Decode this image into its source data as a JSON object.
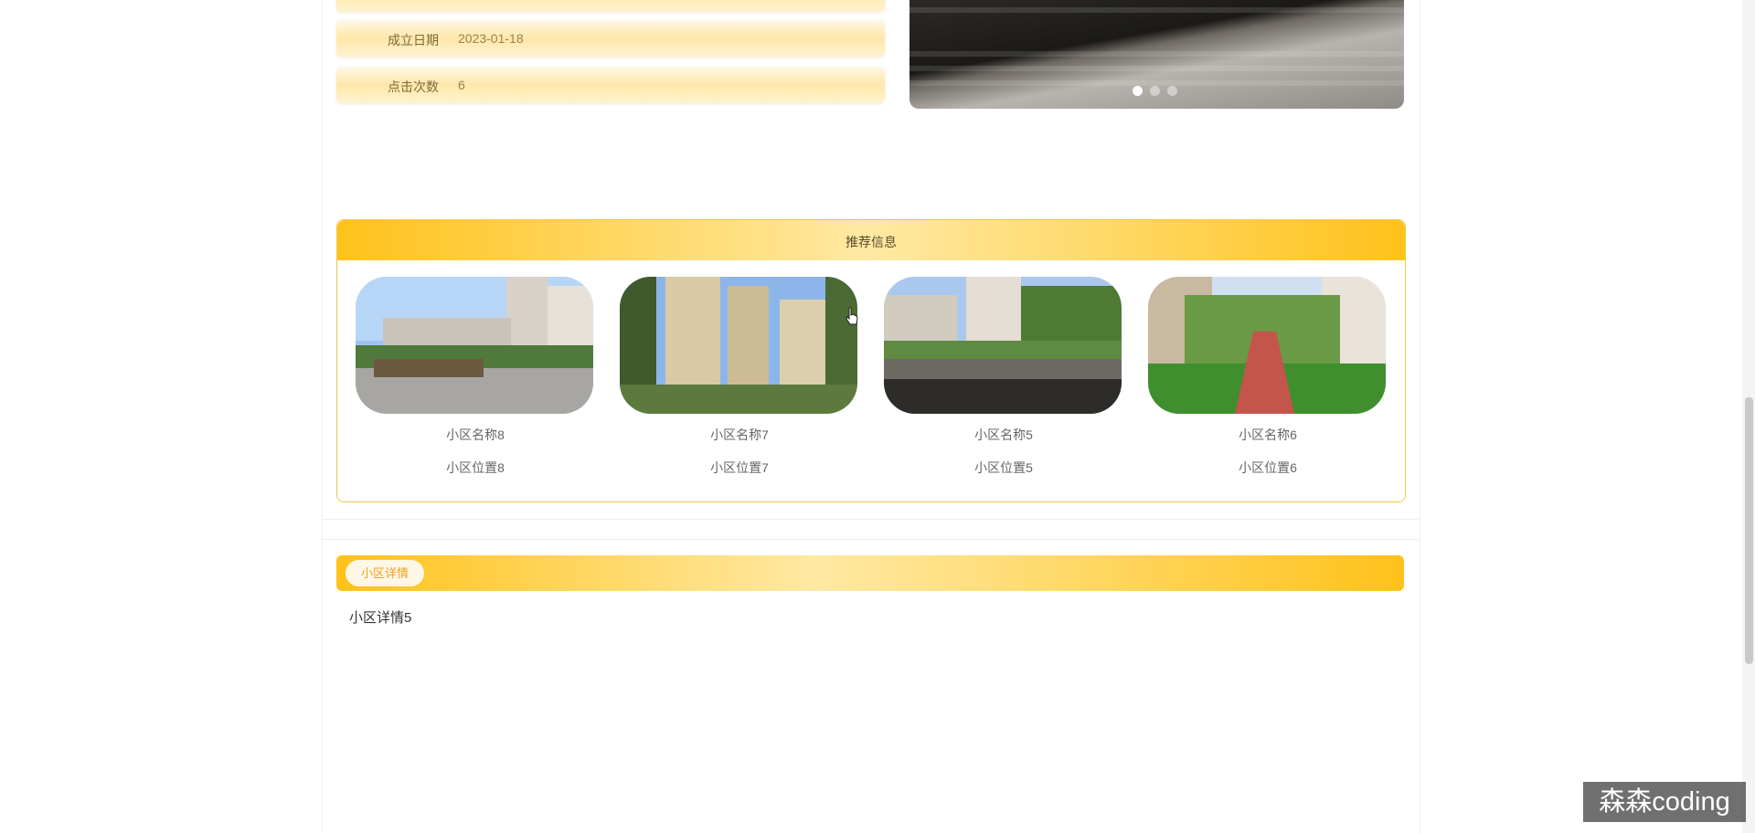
{
  "info": {
    "established_label": "成立日期",
    "established_value": "2023-01-18",
    "clicks_label": "点击次数",
    "clicks_value": "6"
  },
  "carousel": {
    "dots": 3,
    "active_dot": 1
  },
  "recommend": {
    "title": "推荐信息",
    "items": [
      {
        "name": "小区名称8",
        "location": "小区位置8"
      },
      {
        "name": "小区名称7",
        "location": "小区位置7"
      },
      {
        "name": "小区名称5",
        "location": "小区位置5"
      },
      {
        "name": "小区名称6",
        "location": "小区位置6"
      }
    ]
  },
  "detail": {
    "tab_label": "小区详情",
    "content": "小区详情5"
  },
  "watermark": "森森coding",
  "colors": {
    "accent_yellow": "#ffc21a",
    "accent_light": "#ffe9a3",
    "tab_text": "#f0a01a"
  }
}
